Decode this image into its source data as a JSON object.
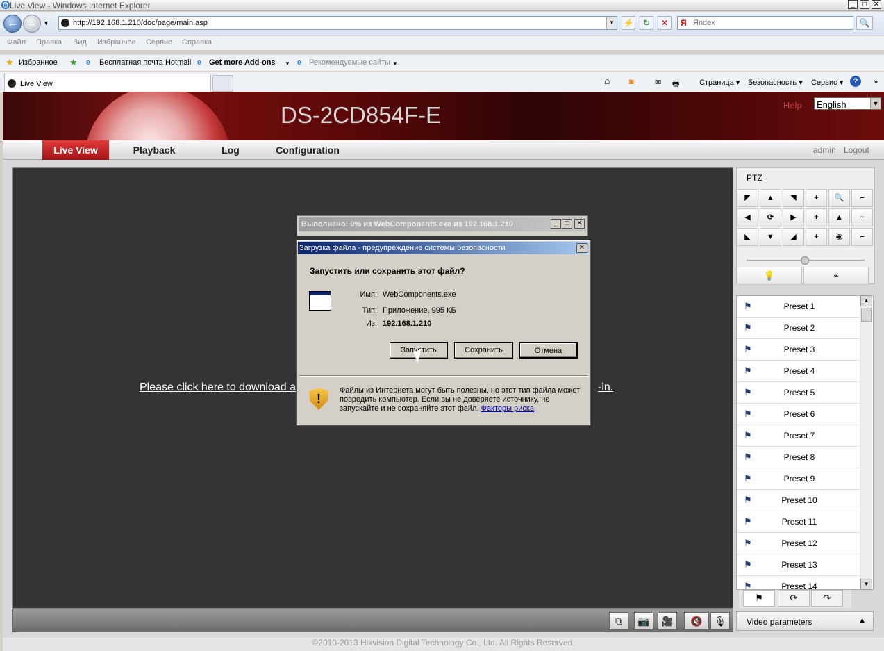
{
  "window": {
    "title": "Live View - Windows Internet Explorer"
  },
  "browser": {
    "url": "http://192.168.1.210/doc/page/main.asp",
    "search_placeholder": "Яndex",
    "menus": [
      "Файл",
      "Правка",
      "Вид",
      "Избранное",
      "Сервис",
      "Справка"
    ],
    "favorites_label": "Избранное",
    "favorites": [
      "Бесплатная почта Hotmail",
      "Get more Add-ons",
      "Рекомендуемые сайты"
    ],
    "tab_title": "Live View",
    "commands": [
      "Страница",
      "Безопасность",
      "Сервис"
    ]
  },
  "header": {
    "model": "DS-2CD854F-E",
    "help": "Help",
    "language": "English"
  },
  "nav": {
    "items": [
      "Live View",
      "Playback",
      "Log",
      "Configuration"
    ],
    "user": "admin",
    "logout": "Logout"
  },
  "video": {
    "download_text": "Please click here to download ar",
    "download_text_end": "-in."
  },
  "ptz": {
    "title": "PTZ",
    "presets": [
      "Preset 1",
      "Preset 2",
      "Preset 3",
      "Preset 4",
      "Preset 5",
      "Preset 6",
      "Preset 7",
      "Preset 8",
      "Preset 9",
      "Preset 10",
      "Preset 11",
      "Preset 12",
      "Preset 13",
      "Preset 14"
    ],
    "video_params": "Video parameters"
  },
  "footer": "©2010-2013 Hikvision Digital Technology Co., Ltd. All Rights Reserved.",
  "progress_dialog": {
    "title": "Выполнено: 0% из WebComponents.exe из 192.168.1.210"
  },
  "security_dialog": {
    "title": "Загрузка файла - предупреждение системы безопасности",
    "question": "Запустить или сохранить этот файл?",
    "name_label": "Имя:",
    "name_value": "WebComponents.exe",
    "type_label": "Тип:",
    "type_value": "Приложение, 995 КБ",
    "from_label": "Из:",
    "from_value": "192.168.1.210",
    "run": "Запустить",
    "save": "Сохранить",
    "cancel": "Отмена",
    "warning": "Файлы из Интернета могут быть полезны, но этот тип файла может повредить компьютер. Если вы не доверяете источнику, не запускайте и не сохраняйте этот файл.",
    "risk_link": "Факторы риска"
  }
}
